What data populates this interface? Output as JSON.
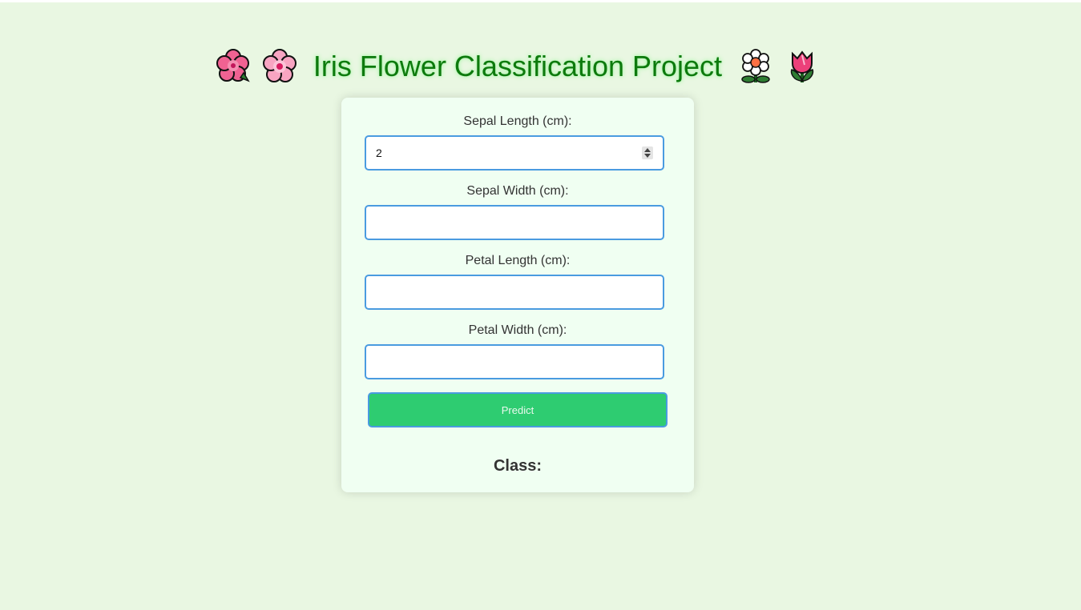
{
  "page": {
    "title": "Iris Flower Classification Project",
    "title_emojis": [
      "hibiscus-icon",
      "cherry-blossom-icon",
      "blossom-icon",
      "tulip-icon"
    ]
  },
  "form": {
    "fields": [
      {
        "label": "Sepal Length (cm):",
        "value": "2"
      },
      {
        "label": "Sepal Width (cm):",
        "value": ""
      },
      {
        "label": "Petal Length (cm):",
        "value": ""
      },
      {
        "label": "Petal Width (cm):",
        "value": ""
      }
    ],
    "predict_label": "Predict"
  },
  "result": {
    "label": "Class:"
  },
  "colors": {
    "background": "#e9f7e2",
    "title": "#0d7a0d",
    "card": "#f0fff2",
    "input_border": "#4a9be0",
    "button": "#2ecc71"
  }
}
